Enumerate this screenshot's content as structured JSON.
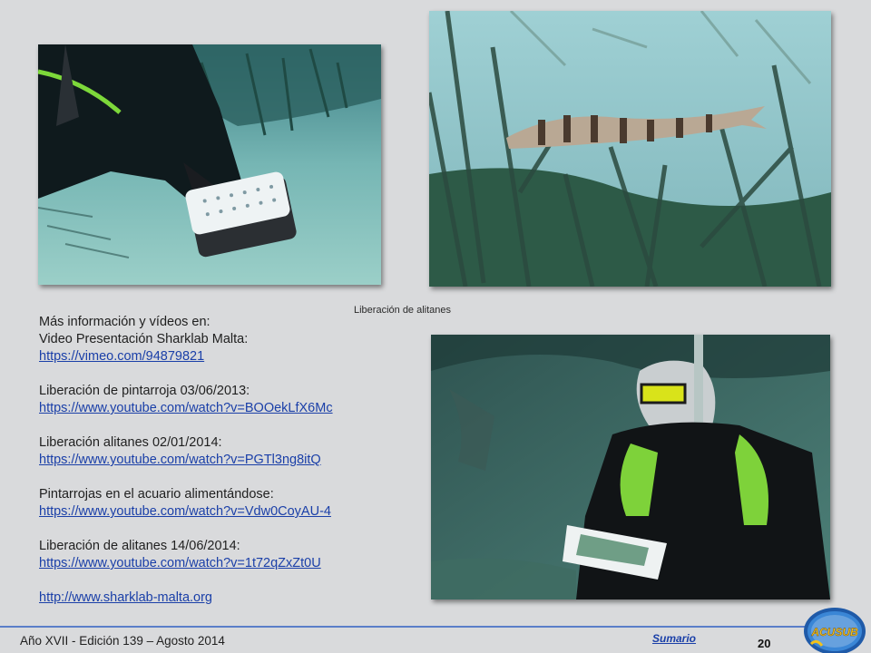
{
  "caption": "Liberación de alitanes",
  "info": {
    "heading": "Más información y vídeos en:",
    "entries": [
      {
        "label": "Video Presentación Sharklab Malta:",
        "url": "https://vimeo.com/94879821"
      },
      {
        "label": "Liberación de pintarroja 03/06/2013:",
        "url": "https://www.youtube.com/watch?v=BOOekLfX6Mc"
      },
      {
        "label": "Liberación alitanes 02/01/2014:",
        "url": "https://www.youtube.com/watch?v=PGTl3ng8itQ"
      },
      {
        "label": "Pintarrojas en el acuario alimentándose:",
        "url": "https://www.youtube.com/watch?v=Vdw0CoyAU-4"
      },
      {
        "label": "Liberación de alitanes 14/06/2014:",
        "url": "https://www.youtube.com/watch?v=1t72qZxZt0U"
      }
    ],
    "site_url": "http://www.sharklab-malta.org"
  },
  "footer": {
    "edition": "Año XVII - Edición 139 – Agosto 2014",
    "sumario": "Sumario",
    "page_number": "20"
  },
  "logo": {
    "text": "ACUSUB"
  },
  "colors": {
    "background": "#d9dadc",
    "link": "#1a3fa8",
    "footer_rule": "#5b7ec9"
  }
}
